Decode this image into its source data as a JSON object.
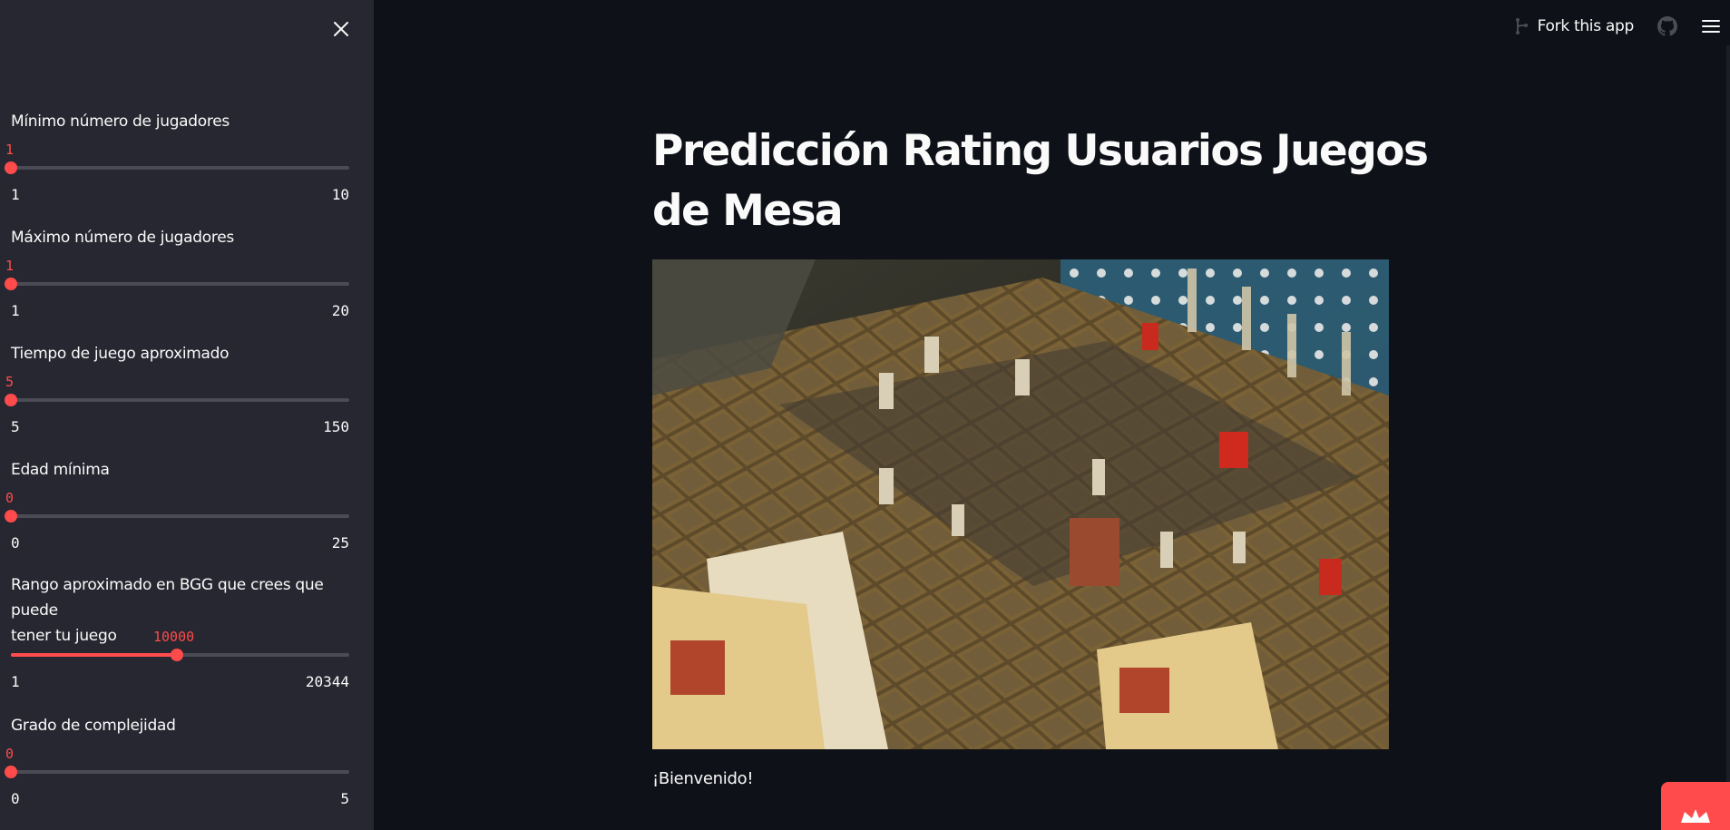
{
  "sidebar": {
    "close_icon": "close-icon",
    "sliders": [
      {
        "label": "Mínimo número de jugadores",
        "value": "1",
        "min": "1",
        "max": "10",
        "fraction": 0
      },
      {
        "label": "Máximo número de jugadores",
        "value": "1",
        "min": "1",
        "max": "20",
        "fraction": 0
      },
      {
        "label": "Tiempo de juego aproximado",
        "value": "5",
        "min": "5",
        "max": "150",
        "fraction": 0
      },
      {
        "label": "Edad mínima",
        "value": "0",
        "min": "0",
        "max": "25",
        "fraction": 0
      },
      {
        "label_line1": "Rango aproximado en BGG que crees que puede",
        "label_line2": "tener tu juego",
        "value": "10000",
        "min": "1",
        "max": "20344",
        "fraction": 0.4915
      },
      {
        "label": "Grado de complejidad",
        "value": "0",
        "min": "0",
        "max": "5",
        "fraction": 0
      }
    ]
  },
  "header": {
    "fork_label": "Fork this app",
    "fork_icon": "git-fork-icon",
    "github_icon": "github-icon",
    "menu_icon": "hamburger-menu-icon"
  },
  "main": {
    "title": "Predicción Rating Usuarios Juegos de Mesa",
    "image_alt": "Board game HeroQuest on a table",
    "welcome": "¡Bienvenido!"
  },
  "colors": {
    "accent": "#ff4b4b",
    "background": "#0e1117",
    "sidebar": "#262730"
  }
}
